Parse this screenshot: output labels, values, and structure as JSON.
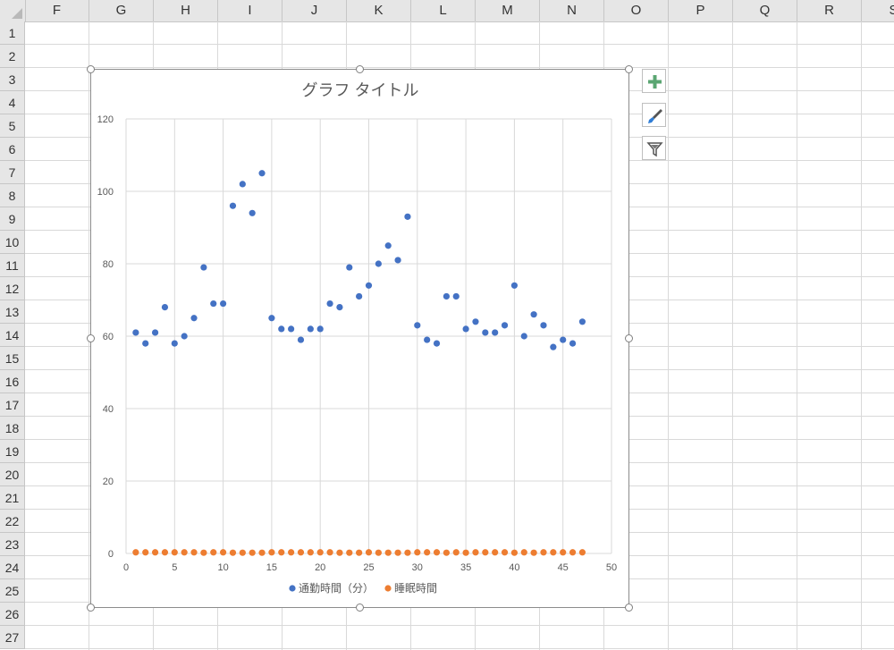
{
  "sheet": {
    "columns": [
      "F",
      "G",
      "H",
      "I",
      "J",
      "K",
      "L",
      "M",
      "N",
      "O",
      "P",
      "Q",
      "R",
      "S"
    ],
    "rows": [
      "1",
      "2",
      "3",
      "4",
      "5",
      "6",
      "7",
      "8",
      "9",
      "10",
      "11",
      "12",
      "13",
      "14",
      "15",
      "16",
      "17",
      "18",
      "19",
      "20",
      "21",
      "22",
      "23",
      "24",
      "25",
      "26",
      "27"
    ]
  },
  "chart_buttons": {
    "add_element": "plus-icon",
    "style": "brush-icon",
    "filter": "filter-icon"
  },
  "chart_data": {
    "type": "scatter",
    "title": "グラフ タイトル",
    "xlim": [
      0,
      50
    ],
    "ylim": [
      0,
      120
    ],
    "x_ticks": [
      "0",
      "5",
      "10",
      "15",
      "20",
      "25",
      "30",
      "35",
      "40",
      "45",
      "50"
    ],
    "y_ticks": [
      "0",
      "20",
      "40",
      "60",
      "80",
      "100",
      "120"
    ],
    "grid": true,
    "legend_position": "bottom",
    "series": [
      {
        "name": "通勤時間（分）",
        "color": "#4472c4",
        "x": [
          1,
          2,
          3,
          4,
          5,
          6,
          7,
          8,
          9,
          10,
          11,
          12,
          13,
          14,
          15,
          16,
          17,
          18,
          19,
          20,
          21,
          22,
          23,
          24,
          25,
          26,
          27,
          28,
          29,
          30,
          31,
          32,
          33,
          34,
          35,
          36,
          37,
          38,
          39,
          40,
          41,
          42,
          43,
          44,
          45,
          46,
          47
        ],
        "y": [
          61,
          58,
          61,
          68,
          58,
          60,
          65,
          79,
          69,
          69,
          96,
          102,
          94,
          105,
          65,
          62,
          62,
          59,
          62,
          62,
          69,
          68,
          79,
          71,
          74,
          80,
          85,
          81,
          93,
          63,
          59,
          58,
          71,
          71,
          62,
          64,
          61,
          61,
          63,
          74,
          60,
          66,
          63,
          57,
          59,
          58,
          64
        ]
      },
      {
        "name": "睡眠時間",
        "color": "#ed7d31",
        "x": [
          1,
          2,
          3,
          4,
          5,
          6,
          7,
          8,
          9,
          10,
          11,
          12,
          13,
          14,
          15,
          16,
          17,
          18,
          19,
          20,
          21,
          22,
          23,
          24,
          25,
          26,
          27,
          28,
          29,
          30,
          31,
          32,
          33,
          34,
          35,
          36,
          37,
          38,
          39,
          40,
          41,
          42,
          43,
          44,
          45,
          46,
          47
        ],
        "y": [
          0.3,
          0.3,
          0.3,
          0.3,
          0.3,
          0.3,
          0.3,
          0.2,
          0.3,
          0.3,
          0.2,
          0.2,
          0.2,
          0.2,
          0.3,
          0.3,
          0.3,
          0.3,
          0.3,
          0.3,
          0.3,
          0.2,
          0.2,
          0.2,
          0.3,
          0.2,
          0.2,
          0.2,
          0.2,
          0.3,
          0.3,
          0.3,
          0.2,
          0.3,
          0.2,
          0.3,
          0.3,
          0.3,
          0.3,
          0.2,
          0.3,
          0.2,
          0.3,
          0.3,
          0.3,
          0.3,
          0.3
        ]
      }
    ]
  }
}
